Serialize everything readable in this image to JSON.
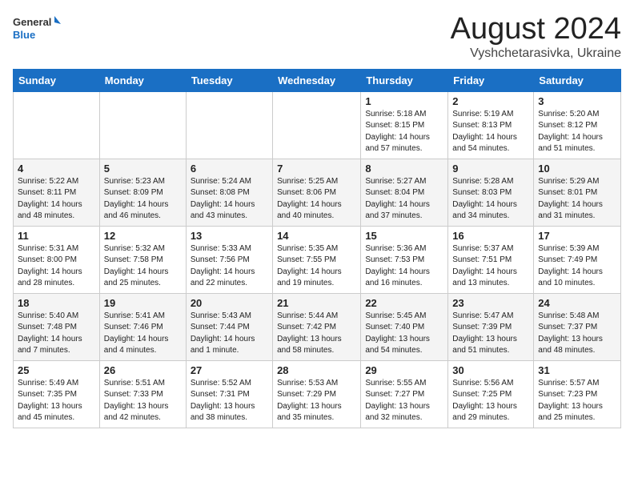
{
  "header": {
    "logo_general": "General",
    "logo_blue": "Blue",
    "title": "August 2024",
    "subtitle": "Vyshchetarasivka, Ukraine"
  },
  "weekdays": [
    "Sunday",
    "Monday",
    "Tuesday",
    "Wednesday",
    "Thursday",
    "Friday",
    "Saturday"
  ],
  "weeks": [
    [
      {
        "day": "",
        "info": ""
      },
      {
        "day": "",
        "info": ""
      },
      {
        "day": "",
        "info": ""
      },
      {
        "day": "",
        "info": ""
      },
      {
        "day": "1",
        "info": "Sunrise: 5:18 AM\nSunset: 8:15 PM\nDaylight: 14 hours\nand 57 minutes."
      },
      {
        "day": "2",
        "info": "Sunrise: 5:19 AM\nSunset: 8:13 PM\nDaylight: 14 hours\nand 54 minutes."
      },
      {
        "day": "3",
        "info": "Sunrise: 5:20 AM\nSunset: 8:12 PM\nDaylight: 14 hours\nand 51 minutes."
      }
    ],
    [
      {
        "day": "4",
        "info": "Sunrise: 5:22 AM\nSunset: 8:11 PM\nDaylight: 14 hours\nand 48 minutes."
      },
      {
        "day": "5",
        "info": "Sunrise: 5:23 AM\nSunset: 8:09 PM\nDaylight: 14 hours\nand 46 minutes."
      },
      {
        "day": "6",
        "info": "Sunrise: 5:24 AM\nSunset: 8:08 PM\nDaylight: 14 hours\nand 43 minutes."
      },
      {
        "day": "7",
        "info": "Sunrise: 5:25 AM\nSunset: 8:06 PM\nDaylight: 14 hours\nand 40 minutes."
      },
      {
        "day": "8",
        "info": "Sunrise: 5:27 AM\nSunset: 8:04 PM\nDaylight: 14 hours\nand 37 minutes."
      },
      {
        "day": "9",
        "info": "Sunrise: 5:28 AM\nSunset: 8:03 PM\nDaylight: 14 hours\nand 34 minutes."
      },
      {
        "day": "10",
        "info": "Sunrise: 5:29 AM\nSunset: 8:01 PM\nDaylight: 14 hours\nand 31 minutes."
      }
    ],
    [
      {
        "day": "11",
        "info": "Sunrise: 5:31 AM\nSunset: 8:00 PM\nDaylight: 14 hours\nand 28 minutes."
      },
      {
        "day": "12",
        "info": "Sunrise: 5:32 AM\nSunset: 7:58 PM\nDaylight: 14 hours\nand 25 minutes."
      },
      {
        "day": "13",
        "info": "Sunrise: 5:33 AM\nSunset: 7:56 PM\nDaylight: 14 hours\nand 22 minutes."
      },
      {
        "day": "14",
        "info": "Sunrise: 5:35 AM\nSunset: 7:55 PM\nDaylight: 14 hours\nand 19 minutes."
      },
      {
        "day": "15",
        "info": "Sunrise: 5:36 AM\nSunset: 7:53 PM\nDaylight: 14 hours\nand 16 minutes."
      },
      {
        "day": "16",
        "info": "Sunrise: 5:37 AM\nSunset: 7:51 PM\nDaylight: 14 hours\nand 13 minutes."
      },
      {
        "day": "17",
        "info": "Sunrise: 5:39 AM\nSunset: 7:49 PM\nDaylight: 14 hours\nand 10 minutes."
      }
    ],
    [
      {
        "day": "18",
        "info": "Sunrise: 5:40 AM\nSunset: 7:48 PM\nDaylight: 14 hours\nand 7 minutes."
      },
      {
        "day": "19",
        "info": "Sunrise: 5:41 AM\nSunset: 7:46 PM\nDaylight: 14 hours\nand 4 minutes."
      },
      {
        "day": "20",
        "info": "Sunrise: 5:43 AM\nSunset: 7:44 PM\nDaylight: 14 hours\nand 1 minute."
      },
      {
        "day": "21",
        "info": "Sunrise: 5:44 AM\nSunset: 7:42 PM\nDaylight: 13 hours\nand 58 minutes."
      },
      {
        "day": "22",
        "info": "Sunrise: 5:45 AM\nSunset: 7:40 PM\nDaylight: 13 hours\nand 54 minutes."
      },
      {
        "day": "23",
        "info": "Sunrise: 5:47 AM\nSunset: 7:39 PM\nDaylight: 13 hours\nand 51 minutes."
      },
      {
        "day": "24",
        "info": "Sunrise: 5:48 AM\nSunset: 7:37 PM\nDaylight: 13 hours\nand 48 minutes."
      }
    ],
    [
      {
        "day": "25",
        "info": "Sunrise: 5:49 AM\nSunset: 7:35 PM\nDaylight: 13 hours\nand 45 minutes."
      },
      {
        "day": "26",
        "info": "Sunrise: 5:51 AM\nSunset: 7:33 PM\nDaylight: 13 hours\nand 42 minutes."
      },
      {
        "day": "27",
        "info": "Sunrise: 5:52 AM\nSunset: 7:31 PM\nDaylight: 13 hours\nand 38 minutes."
      },
      {
        "day": "28",
        "info": "Sunrise: 5:53 AM\nSunset: 7:29 PM\nDaylight: 13 hours\nand 35 minutes."
      },
      {
        "day": "29",
        "info": "Sunrise: 5:55 AM\nSunset: 7:27 PM\nDaylight: 13 hours\nand 32 minutes."
      },
      {
        "day": "30",
        "info": "Sunrise: 5:56 AM\nSunset: 7:25 PM\nDaylight: 13 hours\nand 29 minutes."
      },
      {
        "day": "31",
        "info": "Sunrise: 5:57 AM\nSunset: 7:23 PM\nDaylight: 13 hours\nand 25 minutes."
      }
    ]
  ]
}
